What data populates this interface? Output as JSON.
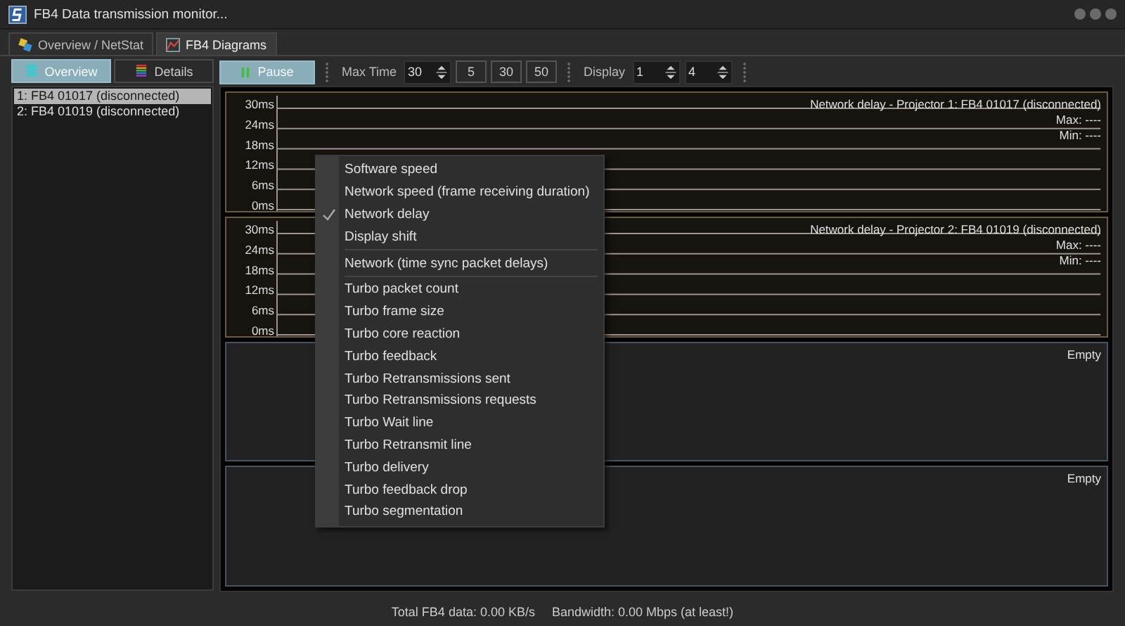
{
  "window": {
    "title": "FB4 Data transmission monitor..."
  },
  "tabs": [
    {
      "label": "Overview / NetStat",
      "selected": false
    },
    {
      "label": "FB4 Diagrams",
      "selected": true
    }
  ],
  "view_buttons": [
    {
      "label": "Overview",
      "selected": true
    },
    {
      "label": "Details",
      "selected": false
    }
  ],
  "projectors": [
    {
      "label": "1: FB4 01017 (disconnected)",
      "selected": true
    },
    {
      "label": "2: FB4 01019 (disconnected)",
      "selected": false
    }
  ],
  "toolbar": {
    "pause": "Pause",
    "max_time_label": "Max Time",
    "max_time": "30",
    "presets": [
      "5",
      "30",
      "50"
    ],
    "display_label": "Display",
    "display_from": "1",
    "display_to": "4"
  },
  "panels": [
    {
      "kind": "chart",
      "title": "Network delay - Projector 1: FB4 01017 (disconnected)",
      "max": "Max: ----",
      "min": "Min: ----",
      "axis_labels": [
        "30ms",
        "24ms",
        "18ms",
        "12ms",
        "6ms",
        "0ms"
      ]
    },
    {
      "kind": "chart",
      "title": "Network delay - Projector 2: FB4 01019 (disconnected)",
      "max": "Max: ----",
      "min": "Min: ----",
      "axis_labels": [
        "30ms",
        "24ms",
        "18ms",
        "12ms",
        "6ms",
        "0ms"
      ]
    },
    {
      "kind": "empty",
      "label": "Empty"
    },
    {
      "kind": "empty",
      "label": "Empty"
    }
  ],
  "context_menu": [
    {
      "label": "Software speed",
      "checked": false,
      "separator_after": false
    },
    {
      "label": "Network speed (frame receiving duration)",
      "checked": false,
      "separator_after": false
    },
    {
      "label": "Network delay",
      "checked": true,
      "separator_after": false
    },
    {
      "label": "Display shift",
      "checked": false,
      "separator_after": true
    },
    {
      "label": "Network (time sync packet delays)",
      "checked": false,
      "separator_after": true
    },
    {
      "label": "Turbo packet count",
      "checked": false,
      "separator_after": false
    },
    {
      "label": "Turbo frame size",
      "checked": false,
      "separator_after": false
    },
    {
      "label": "Turbo core reaction",
      "checked": false,
      "separator_after": false
    },
    {
      "label": "Turbo feedback",
      "checked": false,
      "separator_after": false
    },
    {
      "label": "Turbo Retransmissions sent",
      "checked": false,
      "separator_after": false
    },
    {
      "label": "Turbo Retransmissions requests",
      "checked": false,
      "separator_after": false
    },
    {
      "label": "Turbo Wait line",
      "checked": false,
      "separator_after": false
    },
    {
      "label": "Turbo Retransmit line",
      "checked": false,
      "separator_after": false
    },
    {
      "label": "Turbo delivery",
      "checked": false,
      "separator_after": false
    },
    {
      "label": "Turbo feedback drop",
      "checked": false,
      "separator_after": false
    },
    {
      "label": "Turbo segmentation",
      "checked": false,
      "separator_after": false
    }
  ],
  "status_bar": {
    "total": "Total FB4 data: 0.00 KB/s",
    "bandwidth": "Bandwidth: 0.00 Mbps (at least!)"
  }
}
